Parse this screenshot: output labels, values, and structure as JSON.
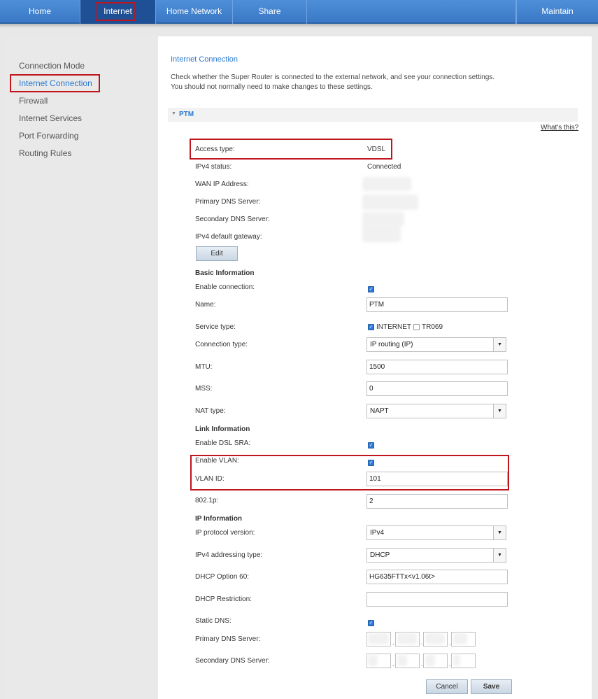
{
  "nav": {
    "items": [
      {
        "label": "Home"
      },
      {
        "label": "Internet"
      },
      {
        "label": "Home Network"
      },
      {
        "label": "Share"
      },
      {
        "label": "Maintain"
      }
    ]
  },
  "sidebar": {
    "items": [
      {
        "label": "Connection Mode"
      },
      {
        "label": "Internet Connection"
      },
      {
        "label": "Firewall"
      },
      {
        "label": "Internet Services"
      },
      {
        "label": "Port Forwarding"
      },
      {
        "label": "Routing Rules"
      }
    ]
  },
  "main": {
    "title": "Internet Connection",
    "description_line1": "Check whether the Super Router is connected to the external network, and see your connection settings.",
    "description_line2": "You should not normally need to make changes to these settings.",
    "section_label": "PTM",
    "whats_this": "What's this?",
    "status": {
      "access_type_label": "Access type:",
      "access_type_value": "VDSL",
      "ipv4_status_label": "IPv4 status:",
      "ipv4_status_value": "Connected",
      "wan_ip_label": "WAN IP Address:",
      "primary_dns_label": "Primary DNS Server:",
      "secondary_dns_label": "Secondary DNS Server:",
      "gateway_label": "IPv4 default gateway:",
      "edit_label": "Edit"
    },
    "basic": {
      "heading": "Basic Information",
      "enable_label": "Enable connection:",
      "name_label": "Name:",
      "name_value": "PTM",
      "service_type_label": "Service type:",
      "service_internet": "INTERNET",
      "service_tr069": "TR069",
      "connection_type_label": "Connection type:",
      "connection_type_value": "IP routing (IP)",
      "mtu_label": "MTU:",
      "mtu_value": "1500",
      "mss_label": "MSS:",
      "mss_value": "0",
      "nat_type_label": "NAT type:",
      "nat_type_value": "NAPT"
    },
    "link": {
      "heading": "Link Information",
      "dsl_sra_label": "Enable DSL SRA:",
      "vlan_label": "Enable VLAN:",
      "vlan_id_label": "VLAN ID:",
      "vlan_id_value": "101",
      "dot1p_label": "802.1p:",
      "dot1p_value": "2"
    },
    "ip": {
      "heading": "IP Information",
      "protocol_label": "IP protocol version:",
      "protocol_value": "IPv4",
      "addressing_label": "IPv4 addressing type:",
      "addressing_value": "DHCP",
      "option60_label": "DHCP Option 60:",
      "option60_value": "HG635FTTx<v1.06t>",
      "restriction_label": "DHCP Restriction:",
      "restriction_value": "",
      "static_dns_label": "Static DNS:",
      "primary_dns_label": "Primary DNS Server:",
      "secondary_dns_label": "Secondary DNS Server:"
    },
    "buttons": {
      "cancel": "Cancel",
      "save": "Save"
    }
  },
  "colors": {
    "accent": "#2a7ad0",
    "nav_bg": "#3a78c6",
    "nav_active": "#1f4f94",
    "highlight": "#c0151d"
  }
}
